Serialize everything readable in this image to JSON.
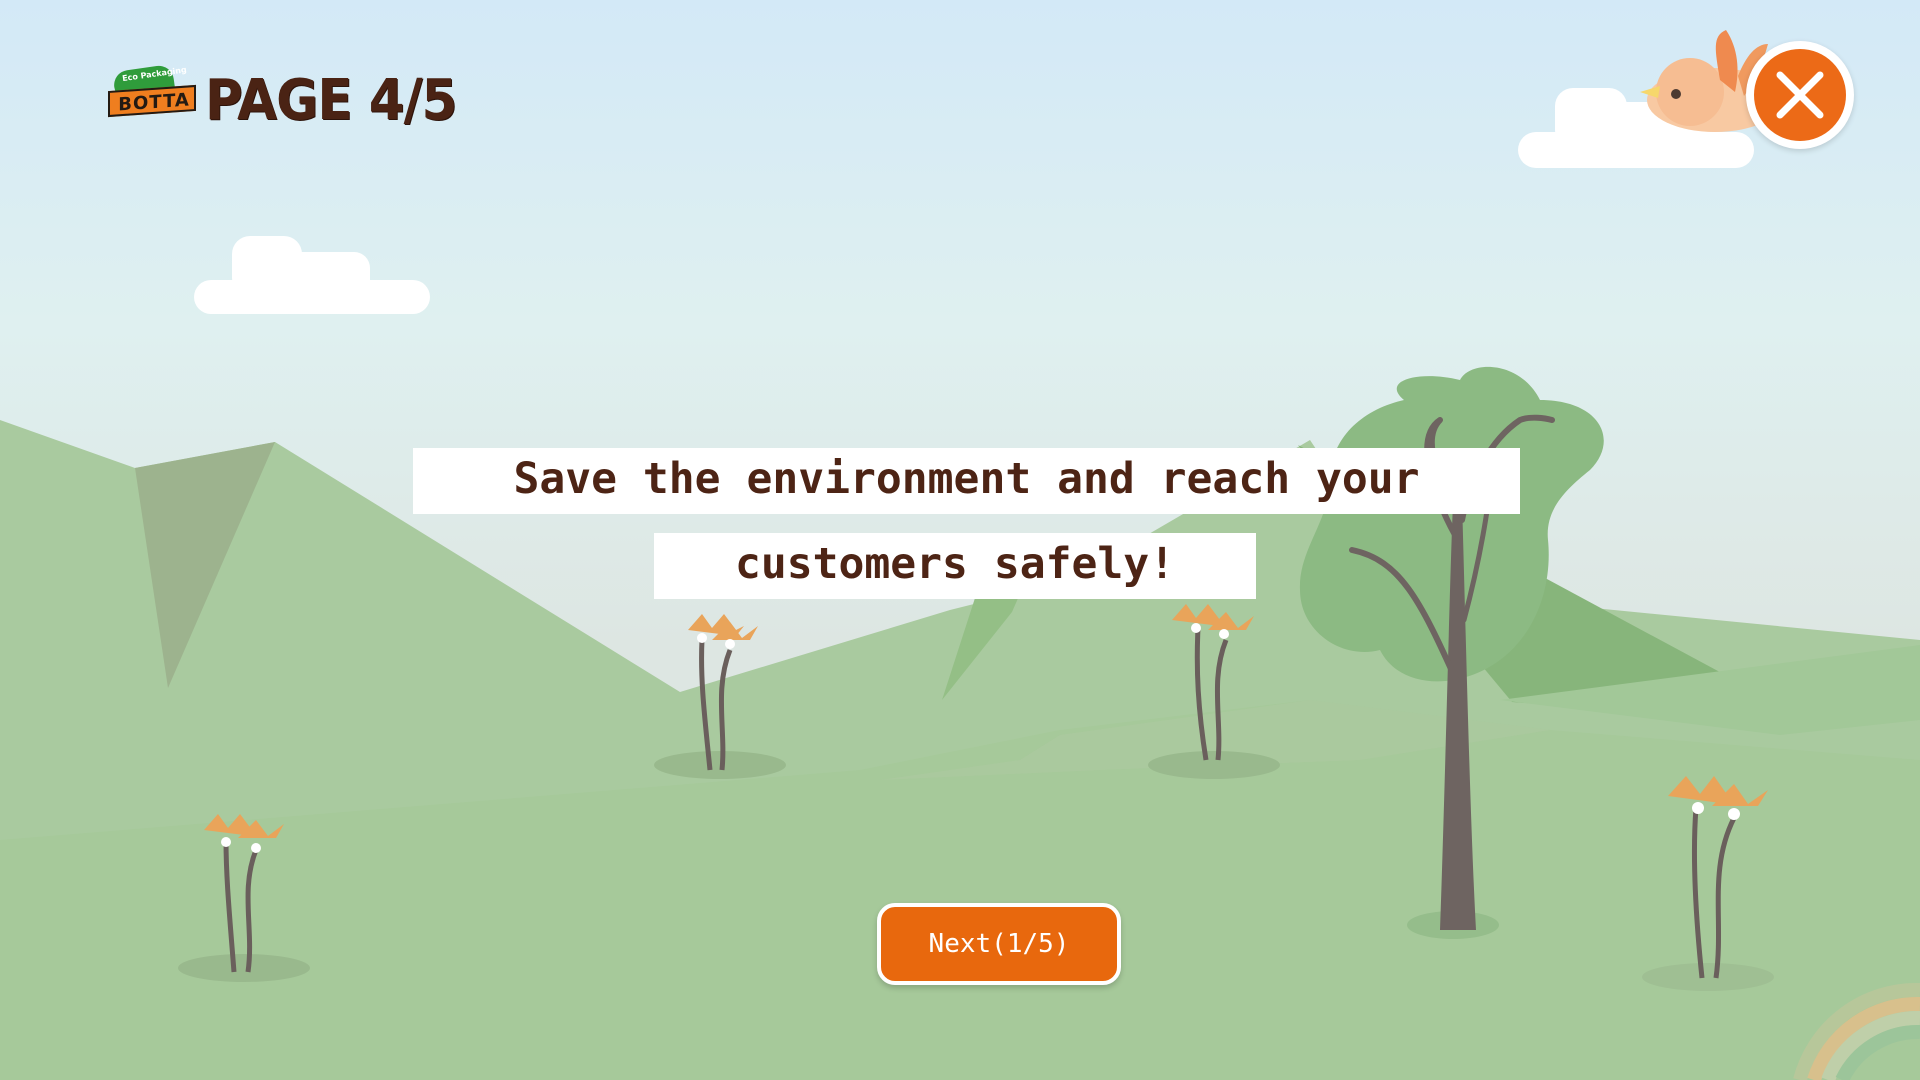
{
  "header": {
    "logo": {
      "tagline": "Eco Packaging",
      "brand": "BOTTA"
    },
    "page_indicator": "PAGE 4/5"
  },
  "message": {
    "line1": "Save the environment and reach your",
    "line2": "customers safely!"
  },
  "next_button": {
    "label": "Next(1/5)"
  },
  "colors": {
    "sky_top": "#d3e9f7",
    "sky_bottom": "#dde6e2",
    "hill": "#a9ca9f",
    "foreground": "#a6c99a",
    "tree_canopy": "#8cba83",
    "trunk": "#6e6461",
    "accent": "#e8680d",
    "text": "#4d2415"
  },
  "icons": [
    "close-icon",
    "bird-icon",
    "tree-icon",
    "flower-icon",
    "cloud-icon",
    "rainbow-icon"
  ]
}
